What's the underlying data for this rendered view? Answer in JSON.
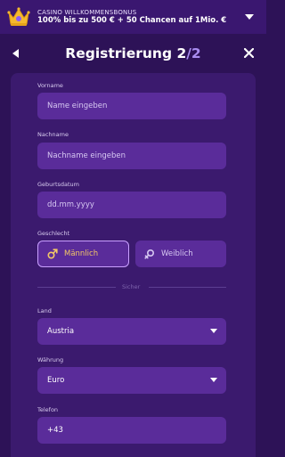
{
  "banner": {
    "label": "CASINO WILLKOMMENSBONUS",
    "offer": "100% bis zu 500 € + 50 Chancen auf 1Mio. €"
  },
  "header": {
    "title": "Registrierung 2",
    "step_separator": "/",
    "step_total": "2"
  },
  "form": {
    "first_name": {
      "label": "Vorname",
      "placeholder": "Name eingeben"
    },
    "last_name": {
      "label": "Nachname",
      "placeholder": "Nachname eingeben"
    },
    "birth_date": {
      "label": "Geburtsdatum",
      "placeholder": "dd.mm.yyyy"
    },
    "gender": {
      "label": "Geschlecht",
      "options": [
        "Männlich",
        "Weiblich"
      ],
      "selected": "Männlich"
    },
    "divider": "Sicher",
    "country": {
      "label": "Land",
      "value": "Austria"
    },
    "currency": {
      "label": "Währung",
      "value": "Euro"
    },
    "phone": {
      "label": "Telefon",
      "value": "+43"
    }
  },
  "colors": {
    "background": "#2d1257",
    "card": "#3b1a6e",
    "input": "#5a2c9a",
    "accent_gold": "#f3c866",
    "accent_violet": "#a98cf0"
  },
  "icons": {
    "crown": "crown-icon",
    "chevron": "chevron-down-icon",
    "back": "back-arrow-icon",
    "close": "close-icon",
    "male": "male-symbol-icon",
    "female": "female-symbol-icon"
  }
}
